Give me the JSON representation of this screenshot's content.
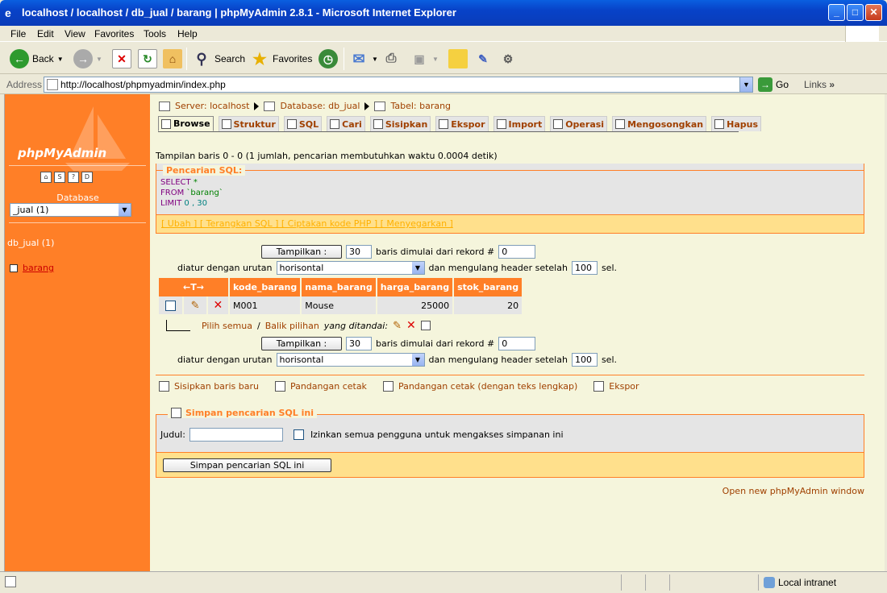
{
  "window": {
    "title": "localhost / localhost / db_jual / barang | phpMyAdmin 2.8.1 - Microsoft Internet Explorer"
  },
  "menu": [
    "File",
    "Edit",
    "View",
    "Favorites",
    "Tools",
    "Help"
  ],
  "toolbar": {
    "back": "Back",
    "search": "Search",
    "favorites": "Favorites"
  },
  "address": {
    "label": "Address",
    "url": "http://localhost/phpmyadmin/index.php",
    "go": "Go",
    "links": "Links"
  },
  "sidebar": {
    "logo": "phpMyAdmin",
    "database_label": "Database",
    "database_selected": "_jual (1)",
    "db_name": "db_jual (1)",
    "table": "barang"
  },
  "breadcrumb": {
    "server": "Server: localhost",
    "database": "Database: db_jual",
    "table": "Tabel: barang"
  },
  "tabs": [
    "Browse",
    "Struktur",
    "SQL",
    "Cari",
    "Sisipkan",
    "Ekspor",
    "Import",
    "Operasi",
    "Mengosongkan",
    "Hapus"
  ],
  "info": "Tampilan baris 0 - 0 (1 jumlah, pencarian membutuhkan waktu 0.0004 detik)",
  "sql": {
    "legend": "Pencarian SQL:",
    "select": "SELECT",
    "star": "*",
    "from": "FROM",
    "table": "`barang`",
    "limit": "LIMIT",
    "limit_vals": "0 , 30",
    "links": "[ Ubah ] [ Terangkan SQL ] [ Ciptakan kode PHP ] [ Menyegarkan ]"
  },
  "controls": {
    "show_btn": "Tampilkan :",
    "rows": "30",
    "rows_from": "baris dimulai dari rekord #",
    "start": "0",
    "ordered": "diatur dengan urutan",
    "mode": "horisontal",
    "repeat": "dan mengulang header setelah",
    "repeat_val": "100",
    "cells": "sel."
  },
  "table": {
    "arrows": "←T→",
    "headers": [
      "kode_barang",
      "nama_barang",
      "harga_barang",
      "stok_barang"
    ],
    "rows": [
      [
        "M001",
        "Mouse",
        "25000",
        "20"
      ]
    ]
  },
  "checkall": {
    "all": "Pilih semua",
    "sep": "/",
    "invert": "Balik pilihan",
    "marked": "yang ditandai:"
  },
  "actions": [
    "Sisipkan baris baru",
    "Pandangan cetak",
    "Pandangan cetak (dengan teks lengkap)",
    "Ekspor"
  ],
  "save": {
    "legend": "Simpan pencarian SQL ini",
    "label": "Judul:",
    "allow": "Izinkan semua pengguna untuk mengakses simpanan ini",
    "button": "Simpan pencarian SQL ini"
  },
  "newwin": "Open new phpMyAdmin window",
  "status": {
    "zone": "Local intranet"
  }
}
